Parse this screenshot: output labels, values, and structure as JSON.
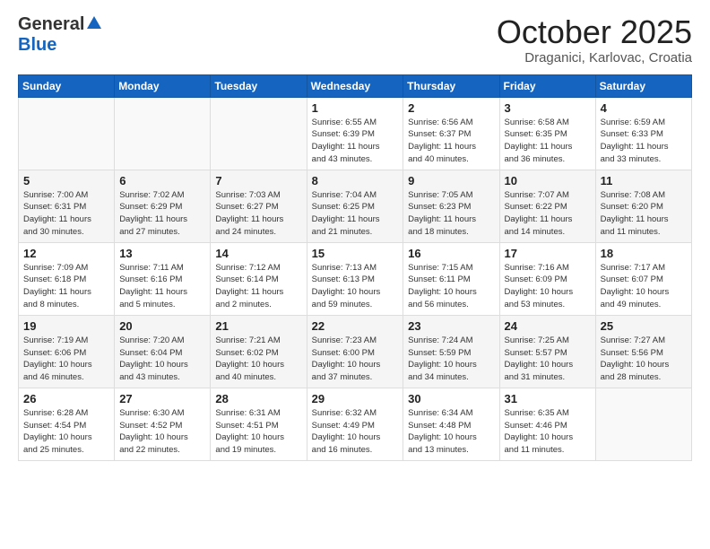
{
  "header": {
    "logo_general": "General",
    "logo_blue": "Blue",
    "month_title": "October 2025",
    "location": "Draganici, Karlovac, Croatia"
  },
  "weekdays": [
    "Sunday",
    "Monday",
    "Tuesday",
    "Wednesday",
    "Thursday",
    "Friday",
    "Saturday"
  ],
  "weeks": [
    [
      {
        "day": "",
        "info": ""
      },
      {
        "day": "",
        "info": ""
      },
      {
        "day": "",
        "info": ""
      },
      {
        "day": "1",
        "info": "Sunrise: 6:55 AM\nSunset: 6:39 PM\nDaylight: 11 hours\nand 43 minutes."
      },
      {
        "day": "2",
        "info": "Sunrise: 6:56 AM\nSunset: 6:37 PM\nDaylight: 11 hours\nand 40 minutes."
      },
      {
        "day": "3",
        "info": "Sunrise: 6:58 AM\nSunset: 6:35 PM\nDaylight: 11 hours\nand 36 minutes."
      },
      {
        "day": "4",
        "info": "Sunrise: 6:59 AM\nSunset: 6:33 PM\nDaylight: 11 hours\nand 33 minutes."
      }
    ],
    [
      {
        "day": "5",
        "info": "Sunrise: 7:00 AM\nSunset: 6:31 PM\nDaylight: 11 hours\nand 30 minutes."
      },
      {
        "day": "6",
        "info": "Sunrise: 7:02 AM\nSunset: 6:29 PM\nDaylight: 11 hours\nand 27 minutes."
      },
      {
        "day": "7",
        "info": "Sunrise: 7:03 AM\nSunset: 6:27 PM\nDaylight: 11 hours\nand 24 minutes."
      },
      {
        "day": "8",
        "info": "Sunrise: 7:04 AM\nSunset: 6:25 PM\nDaylight: 11 hours\nand 21 minutes."
      },
      {
        "day": "9",
        "info": "Sunrise: 7:05 AM\nSunset: 6:23 PM\nDaylight: 11 hours\nand 18 minutes."
      },
      {
        "day": "10",
        "info": "Sunrise: 7:07 AM\nSunset: 6:22 PM\nDaylight: 11 hours\nand 14 minutes."
      },
      {
        "day": "11",
        "info": "Sunrise: 7:08 AM\nSunset: 6:20 PM\nDaylight: 11 hours\nand 11 minutes."
      }
    ],
    [
      {
        "day": "12",
        "info": "Sunrise: 7:09 AM\nSunset: 6:18 PM\nDaylight: 11 hours\nand 8 minutes."
      },
      {
        "day": "13",
        "info": "Sunrise: 7:11 AM\nSunset: 6:16 PM\nDaylight: 11 hours\nand 5 minutes."
      },
      {
        "day": "14",
        "info": "Sunrise: 7:12 AM\nSunset: 6:14 PM\nDaylight: 11 hours\nand 2 minutes."
      },
      {
        "day": "15",
        "info": "Sunrise: 7:13 AM\nSunset: 6:13 PM\nDaylight: 10 hours\nand 59 minutes."
      },
      {
        "day": "16",
        "info": "Sunrise: 7:15 AM\nSunset: 6:11 PM\nDaylight: 10 hours\nand 56 minutes."
      },
      {
        "day": "17",
        "info": "Sunrise: 7:16 AM\nSunset: 6:09 PM\nDaylight: 10 hours\nand 53 minutes."
      },
      {
        "day": "18",
        "info": "Sunrise: 7:17 AM\nSunset: 6:07 PM\nDaylight: 10 hours\nand 49 minutes."
      }
    ],
    [
      {
        "day": "19",
        "info": "Sunrise: 7:19 AM\nSunset: 6:06 PM\nDaylight: 10 hours\nand 46 minutes."
      },
      {
        "day": "20",
        "info": "Sunrise: 7:20 AM\nSunset: 6:04 PM\nDaylight: 10 hours\nand 43 minutes."
      },
      {
        "day": "21",
        "info": "Sunrise: 7:21 AM\nSunset: 6:02 PM\nDaylight: 10 hours\nand 40 minutes."
      },
      {
        "day": "22",
        "info": "Sunrise: 7:23 AM\nSunset: 6:00 PM\nDaylight: 10 hours\nand 37 minutes."
      },
      {
        "day": "23",
        "info": "Sunrise: 7:24 AM\nSunset: 5:59 PM\nDaylight: 10 hours\nand 34 minutes."
      },
      {
        "day": "24",
        "info": "Sunrise: 7:25 AM\nSunset: 5:57 PM\nDaylight: 10 hours\nand 31 minutes."
      },
      {
        "day": "25",
        "info": "Sunrise: 7:27 AM\nSunset: 5:56 PM\nDaylight: 10 hours\nand 28 minutes."
      }
    ],
    [
      {
        "day": "26",
        "info": "Sunrise: 6:28 AM\nSunset: 4:54 PM\nDaylight: 10 hours\nand 25 minutes."
      },
      {
        "day": "27",
        "info": "Sunrise: 6:30 AM\nSunset: 4:52 PM\nDaylight: 10 hours\nand 22 minutes."
      },
      {
        "day": "28",
        "info": "Sunrise: 6:31 AM\nSunset: 4:51 PM\nDaylight: 10 hours\nand 19 minutes."
      },
      {
        "day": "29",
        "info": "Sunrise: 6:32 AM\nSunset: 4:49 PM\nDaylight: 10 hours\nand 16 minutes."
      },
      {
        "day": "30",
        "info": "Sunrise: 6:34 AM\nSunset: 4:48 PM\nDaylight: 10 hours\nand 13 minutes."
      },
      {
        "day": "31",
        "info": "Sunrise: 6:35 AM\nSunset: 4:46 PM\nDaylight: 10 hours\nand 11 minutes."
      },
      {
        "day": "",
        "info": ""
      }
    ]
  ]
}
